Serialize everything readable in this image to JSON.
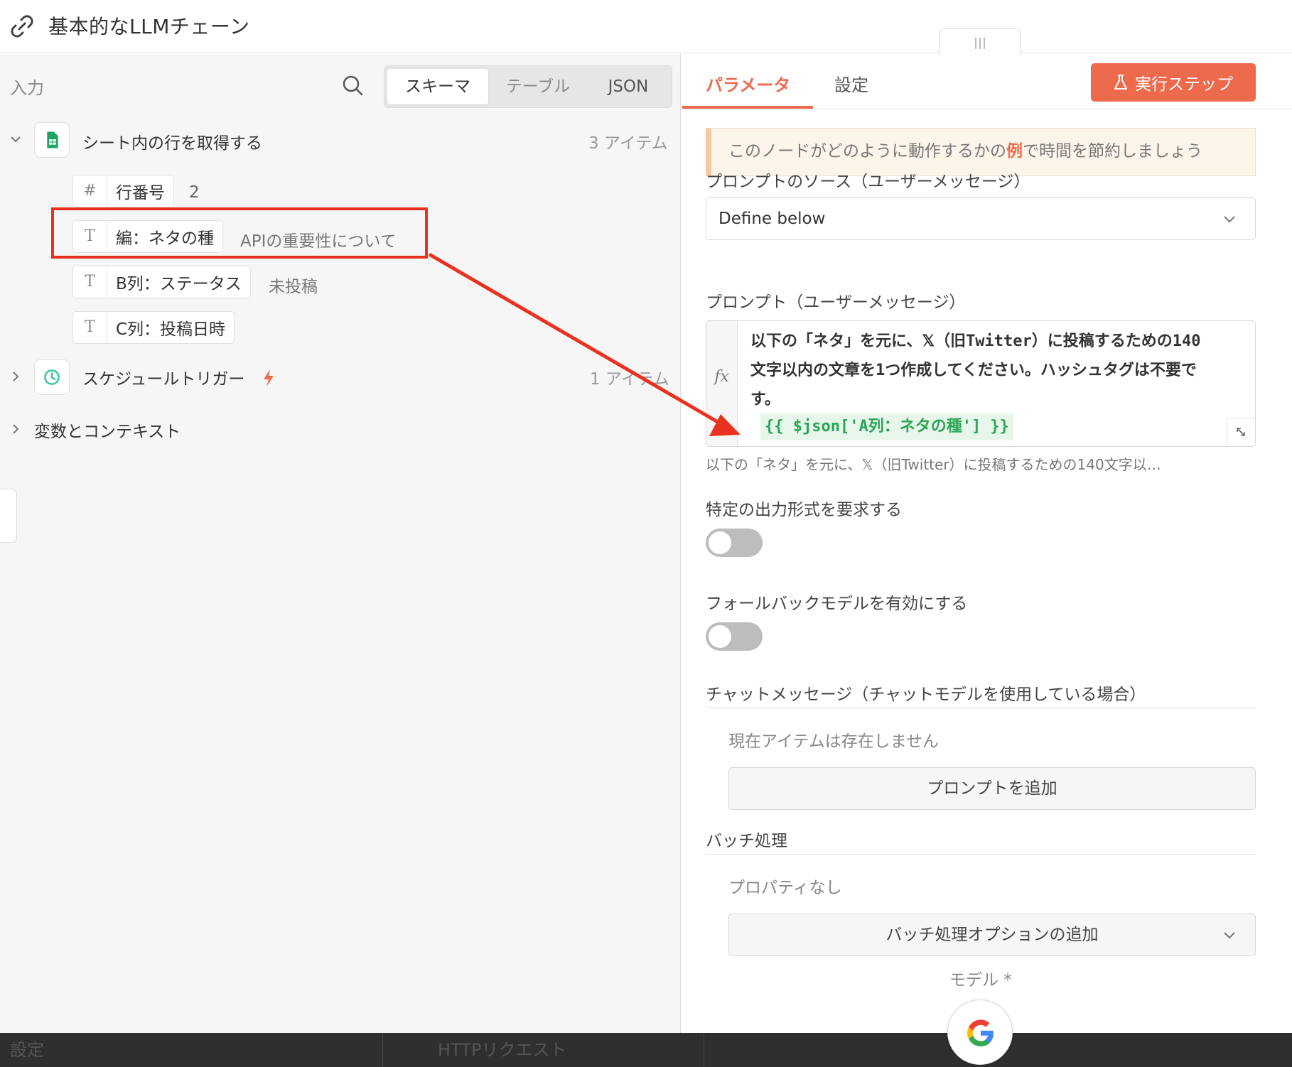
{
  "header": {
    "title": "基本的なLLMチェーン"
  },
  "left": {
    "input_label": "入力",
    "view_tabs": [
      "スキーマ",
      "テーブル",
      "JSON"
    ],
    "active_view": "スキーマ",
    "sheet_node": {
      "title": "シート内の行を取得する",
      "count": "3 アイテム",
      "fields": [
        {
          "type_icon": "#",
          "label": "行番号",
          "value": "2"
        },
        {
          "type_icon": "T",
          "label": "編：ネタの種",
          "value": "APIの重要性について"
        },
        {
          "type_icon": "T",
          "label": "B列：ステータス",
          "value": "未投稿"
        },
        {
          "type_icon": "T",
          "label": "C列：投稿日時",
          "value": ""
        }
      ]
    },
    "trigger_node": {
      "title": "スケジュールトリガー",
      "count": "1 アイテム"
    },
    "vars": {
      "title": "変数とコンテキスト"
    }
  },
  "right": {
    "tabs": [
      "パラメータ",
      "設定"
    ],
    "active_tab": "パラメータ",
    "run_button": "実行ステップ",
    "notice": {
      "prefix": "このノードがどのように動作するかの",
      "link": "例",
      "suffix": "で時間を節約しましょう"
    },
    "prompt_source": {
      "label": "プロンプトのソース（ユーザーメッセージ）",
      "value": "Define below"
    },
    "prompt": {
      "label": "プロンプト（ユーザーメッセージ）",
      "fx": "fx",
      "line1": "以下の「ネタ」を元に、𝕏（旧Twitter）に投稿するための140",
      "line2": "文字以内の文章を1つ作成してください。ハッシュタグは不要で",
      "line3": "す。",
      "expression": "{{ $json['A列：ネタの種'] }}",
      "preview": "以下の「ネタ」を元に、𝕏（旧Twitter）に投稿するための140文字以…"
    },
    "output_format": {
      "label": "特定の出力形式を要求する",
      "enabled": false
    },
    "fallback": {
      "label": "フォールバックモデルを有効にする",
      "enabled": false
    },
    "chat_messages": {
      "label": "チャットメッセージ（チャットモデルを使用している場合）",
      "empty": "現在アイテムは存在しません",
      "add_button": "プロンプトを追加"
    },
    "batch": {
      "label": "バッチ処理",
      "empty": "プロパティなし",
      "add_button": "バッチ処理オプションの追加"
    },
    "model_label": "モデル *"
  },
  "bottom_bar": {
    "left_text": "設定",
    "mid_text": "HTTPリクエスト"
  },
  "colors": {
    "accent": "#ee6a4d",
    "highlight_red": "#e8321f",
    "expression_green": "#2aa455"
  }
}
